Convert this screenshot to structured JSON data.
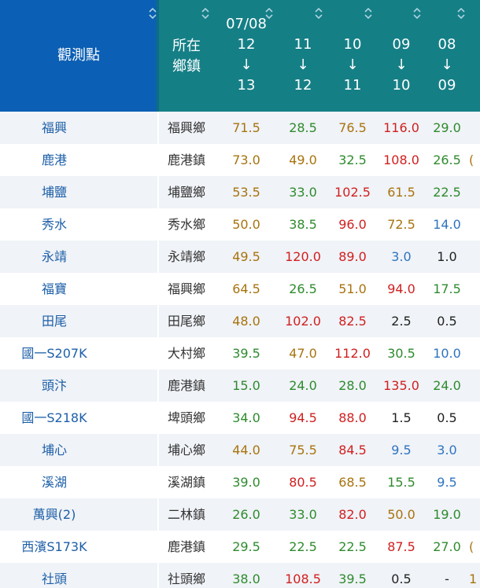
{
  "header": {
    "station_label": "觀測點",
    "town_label_line1": "所在",
    "town_label_line2": "鄉鎮",
    "arrow": "↓",
    "date_prefix": "07/08",
    "columns": [
      {
        "from": "12",
        "to": "13"
      },
      {
        "from": "11",
        "to": "12"
      },
      {
        "from": "10",
        "to": "11"
      },
      {
        "from": "09",
        "to": "10"
      },
      {
        "from": "08",
        "to": "09"
      }
    ],
    "sort_icon_glyph_up": "◇",
    "sort_icon_glyph_down": "◇"
  },
  "level_colors": {
    "green": "#2e8b2e",
    "amber": "#a8730f",
    "red": "#d02020",
    "blue": "#2e74c0",
    "black": "#222222"
  },
  "rows": [
    {
      "station": "福興",
      "town": "福興鄉",
      "values": [
        "71.5",
        "28.5",
        "76.5",
        "116.0",
        "29.0"
      ],
      "levels": [
        "amber",
        "green",
        "amber",
        "red",
        "green"
      ],
      "partial": ""
    },
    {
      "station": "鹿港",
      "town": "鹿港鎮",
      "values": [
        "73.0",
        "49.0",
        "32.5",
        "108.0",
        "26.5"
      ],
      "levels": [
        "amber",
        "amber",
        "green",
        "red",
        "green"
      ],
      "partial": "("
    },
    {
      "station": "埔鹽",
      "town": "埔鹽鄉",
      "values": [
        "53.5",
        "33.0",
        "102.5",
        "61.5",
        "22.5"
      ],
      "levels": [
        "amber",
        "green",
        "red",
        "amber",
        "green"
      ],
      "partial": ""
    },
    {
      "station": "秀水",
      "town": "秀水鄉",
      "values": [
        "50.0",
        "38.5",
        "96.0",
        "72.5",
        "14.0"
      ],
      "levels": [
        "amber",
        "green",
        "red",
        "amber",
        "blue"
      ],
      "partial": ""
    },
    {
      "station": "永靖",
      "town": "永靖鄉",
      "values": [
        "49.5",
        "120.0",
        "89.0",
        "3.0",
        "1.0"
      ],
      "levels": [
        "amber",
        "red",
        "red",
        "blue",
        "black"
      ],
      "partial": ""
    },
    {
      "station": "福寶",
      "town": "福興鄉",
      "values": [
        "64.5",
        "26.5",
        "51.0",
        "94.0",
        "17.5"
      ],
      "levels": [
        "amber",
        "green",
        "amber",
        "red",
        "green"
      ],
      "partial": ""
    },
    {
      "station": "田尾",
      "town": "田尾鄉",
      "values": [
        "48.0",
        "102.0",
        "82.5",
        "2.5",
        "0.5"
      ],
      "levels": [
        "amber",
        "red",
        "red",
        "black",
        "black"
      ],
      "partial": ""
    },
    {
      "station": "國一S207K",
      "town": "大村鄉",
      "values": [
        "39.5",
        "47.0",
        "112.0",
        "30.5",
        "10.0"
      ],
      "levels": [
        "green",
        "amber",
        "red",
        "green",
        "blue"
      ],
      "partial": ""
    },
    {
      "station": "頭汴",
      "town": "鹿港鎮",
      "values": [
        "15.0",
        "24.0",
        "28.0",
        "135.0",
        "24.0"
      ],
      "levels": [
        "green",
        "green",
        "green",
        "red",
        "green"
      ],
      "partial": ""
    },
    {
      "station": "國一S218K",
      "town": "埤頭鄉",
      "values": [
        "34.0",
        "94.5",
        "88.0",
        "1.5",
        "0.5"
      ],
      "levels": [
        "green",
        "red",
        "red",
        "black",
        "black"
      ],
      "partial": ""
    },
    {
      "station": "埔心",
      "town": "埔心鄉",
      "values": [
        "44.0",
        "75.5",
        "84.5",
        "9.5",
        "3.0"
      ],
      "levels": [
        "amber",
        "amber",
        "red",
        "blue",
        "blue"
      ],
      "partial": ""
    },
    {
      "station": "溪湖",
      "town": "溪湖鎮",
      "values": [
        "39.0",
        "80.5",
        "68.5",
        "15.5",
        "9.5"
      ],
      "levels": [
        "green",
        "red",
        "amber",
        "green",
        "blue"
      ],
      "partial": ""
    },
    {
      "station": "萬興(2)",
      "town": "二林鎮",
      "values": [
        "26.0",
        "33.0",
        "82.0",
        "50.0",
        "19.0"
      ],
      "levels": [
        "green",
        "green",
        "red",
        "amber",
        "green"
      ],
      "partial": ""
    },
    {
      "station": "西濱S173K",
      "town": "鹿港鎮",
      "values": [
        "29.5",
        "22.5",
        "22.5",
        "87.5",
        "27.0"
      ],
      "levels": [
        "green",
        "green",
        "green",
        "red",
        "green"
      ],
      "partial": "("
    },
    {
      "station": "社頭",
      "town": "社頭鄉",
      "values": [
        "38.0",
        "108.5",
        "39.5",
        "0.5",
        "-"
      ],
      "levels": [
        "green",
        "red",
        "green",
        "black",
        "black"
      ],
      "partial": "1"
    }
  ]
}
